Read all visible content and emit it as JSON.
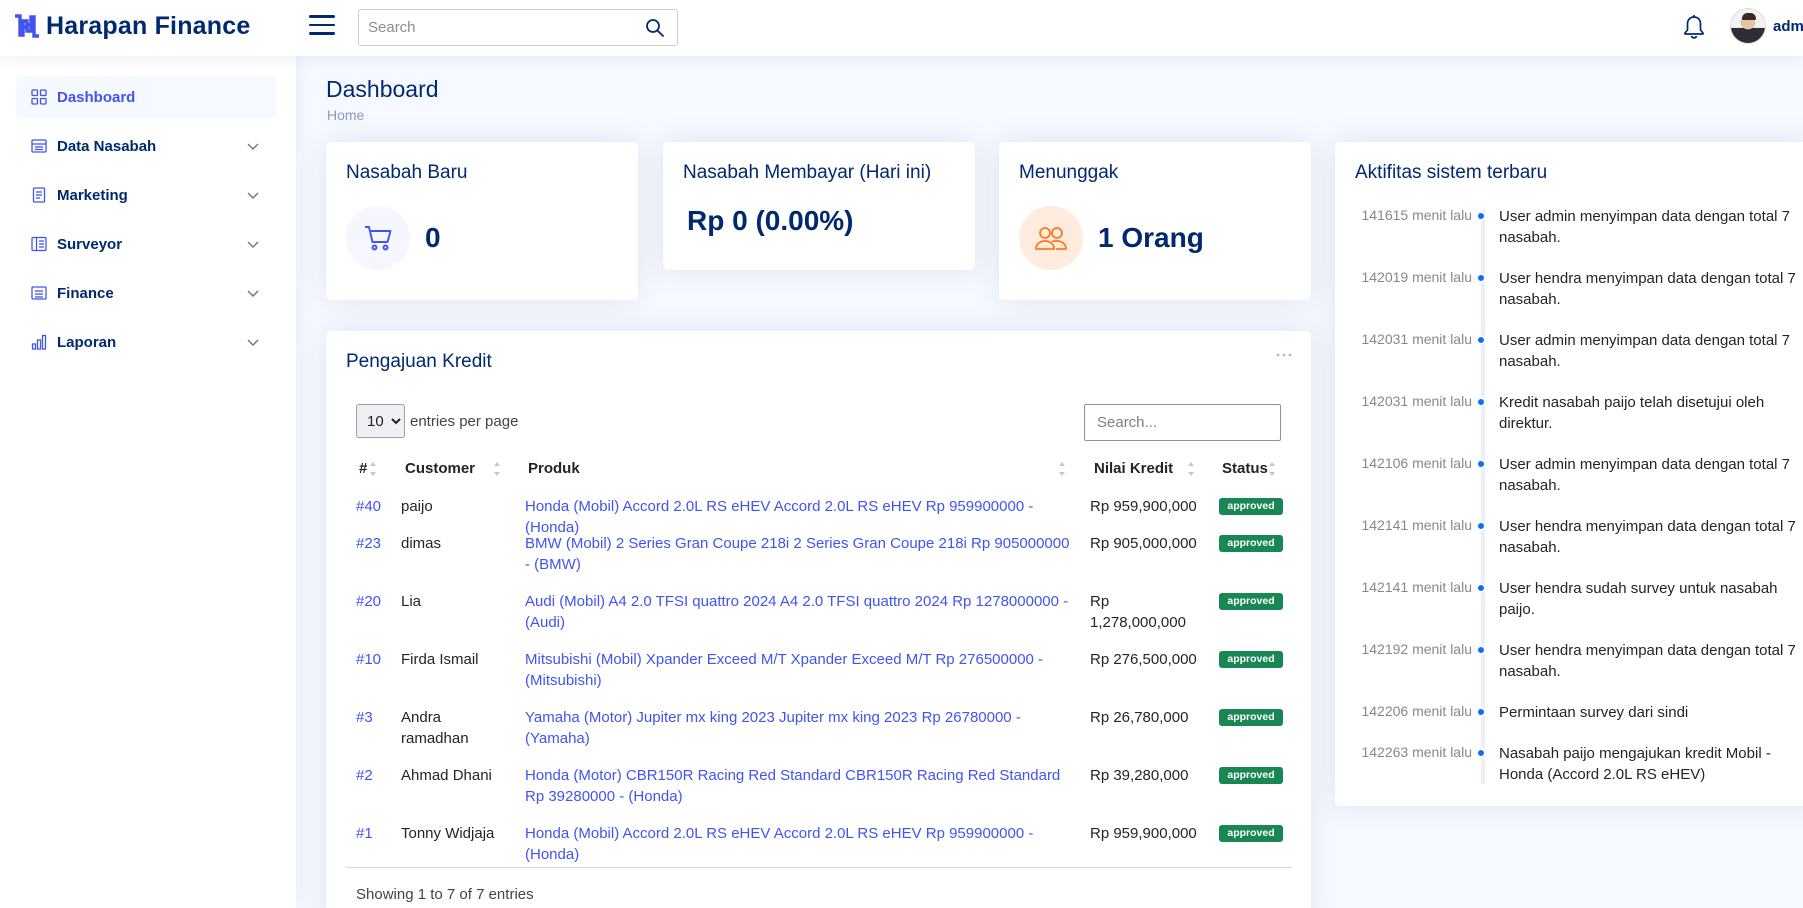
{
  "app": {
    "title": "Harapan Finance",
    "user_name": "admin"
  },
  "header": {
    "search_placeholder": "Search"
  },
  "sidebar": {
    "items": [
      {
        "label": "Dashboard",
        "icon": "grid-icon",
        "active": true
      },
      {
        "label": "Data Nasabah",
        "icon": "table-list-icon"
      },
      {
        "label": "Marketing",
        "icon": "journal-icon"
      },
      {
        "label": "Surveyor",
        "icon": "layout-icon"
      },
      {
        "label": "Finance",
        "icon": "card-list-icon"
      },
      {
        "label": "Laporan",
        "icon": "bar-chart-icon"
      }
    ]
  },
  "page": {
    "title": "Dashboard",
    "breadcrumb": "Home"
  },
  "stats": {
    "nasabah_baru": {
      "title": "Nasabah Baru",
      "value": "0",
      "icon": "cart-icon"
    },
    "nasabah_membayar": {
      "title": "Nasabah Membayar (Hari ini)",
      "value": "Rp 0 (0.00%)"
    },
    "menunggak": {
      "title": "Menunggak",
      "value": "1 Orang",
      "icon": "people-icon"
    }
  },
  "credit_table": {
    "title": "Pengajuan Kredit",
    "per_page": "10",
    "per_page_label": "entries per page",
    "search_placeholder": "Search...",
    "columns": [
      "#",
      "Customer",
      "Produk",
      "Nilai Kredit",
      "Status"
    ],
    "rows": [
      {
        "id": "#40",
        "customer": "paijo",
        "product": "Honda (Mobil) Accord 2.0L RS eHEV Accord 2.0L RS eHEV Rp 959900000 - (Honda)",
        "amount": "Rp 959,900,000",
        "status": "approved"
      },
      {
        "id": "#23",
        "customer": "dimas",
        "product": "BMW (Mobil) 2 Series Gran Coupe 218i 2 Series Gran Coupe 218i Rp 905000000 - (BMW)",
        "amount": "Rp 905,000,000",
        "status": "approved"
      },
      {
        "id": "#20",
        "customer": "Lia",
        "product": "Audi (Mobil) A4 2.0 TFSI quattro 2024 A4 2.0 TFSI quattro 2024 Rp 1278000000 - (Audi)",
        "amount": "Rp 1,278,000,000",
        "status": "approved"
      },
      {
        "id": "#10",
        "customer": "Firda Ismail",
        "product": "Mitsubishi (Mobil) Xpander Exceed M/T Xpander Exceed M/T Rp 276500000 - (Mitsubishi)",
        "amount": "Rp 276,500,000",
        "status": "approved"
      },
      {
        "id": "#3",
        "customer": "Andra ramadhan",
        "product": "Yamaha (Motor) Jupiter mx king 2023 Jupiter mx king 2023 Rp 26780000 - (Yamaha)",
        "amount": "Rp 26,780,000",
        "status": "approved"
      },
      {
        "id": "#2",
        "customer": "Ahmad Dhani",
        "product": "Honda (Motor) CBR150R Racing Red Standard CBR150R Racing Red Standard Rp 39280000 - (Honda)",
        "amount": "Rp 39,280,000",
        "status": "approved"
      },
      {
        "id": "#1",
        "customer": "Tonny Widjaja",
        "product": "Honda (Mobil) Accord 2.0L RS eHEV Accord 2.0L RS eHEV Rp 959900000 - (Honda)",
        "amount": "Rp 959,900,000",
        "status": "approved"
      }
    ],
    "info": "Showing 1 to 7 of 7 entries"
  },
  "activity": {
    "title": "Aktifitas sistem terbaru",
    "items": [
      {
        "time": "141615 menit lalu",
        "text": "User admin menyimpan data dengan total 7 nasabah."
      },
      {
        "time": "142019 menit lalu",
        "text": "User hendra menyimpan data dengan total 7 nasabah."
      },
      {
        "time": "142031 menit lalu",
        "text": "User admin menyimpan data dengan total 7 nasabah."
      },
      {
        "time": "142031 menit lalu",
        "text": "Kredit nasabah paijo telah disetujui oleh direktur."
      },
      {
        "time": "142106 menit lalu",
        "text": "User admin menyimpan data dengan total 7 nasabah."
      },
      {
        "time": "142141 menit lalu",
        "text": "User hendra menyimpan data dengan total 7 nasabah."
      },
      {
        "time": "142141 menit lalu",
        "text": "User hendra sudah survey untuk nasabah paijo."
      },
      {
        "time": "142192 menit lalu",
        "text": "User hendra menyimpan data dengan total 7 nasabah."
      },
      {
        "time": "142206 menit lalu",
        "text": "Permintaan survey dari sindi"
      },
      {
        "time": "142263 menit lalu",
        "text": "Nasabah paijo mengajukan kredit Mobil - Honda (Accord 2.0L RS eHEV)"
      }
    ]
  },
  "colors": {
    "primary": "#4154f1",
    "navy": "#012970",
    "success": "#198754",
    "timeline_dot": "#0d6efd",
    "cart_bg": "#f6f6fe",
    "people_bg": "#ffecdf",
    "people_icon": "#ff771d"
  }
}
